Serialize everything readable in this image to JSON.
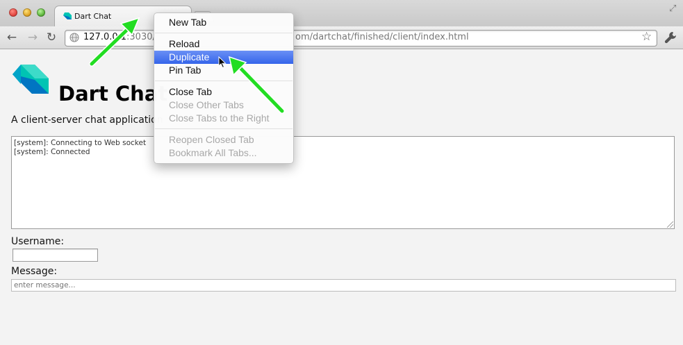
{
  "window": {
    "tab_title": "Dart Chat"
  },
  "toolbar": {
    "url_host": "127.0.0.1",
    "url_after_host": ":3030/",
    "url_tail": "om/dartchat/finished/client/index.html"
  },
  "page": {
    "title": "Dart Chat",
    "subtitle": "A client-server chat application",
    "chat_log": [
      "[system]: Connecting to Web socket",
      "[system]: Connected"
    ],
    "username_label": "Username:",
    "username_value": "",
    "message_label": "Message:",
    "message_placeholder": "enter message..."
  },
  "context_menu": {
    "items": [
      {
        "label": "New Tab",
        "state": "enabled"
      },
      {
        "label": "Reload",
        "state": "enabled"
      },
      {
        "label": "Duplicate",
        "state": "highlighted"
      },
      {
        "label": "Pin Tab",
        "state": "enabled"
      },
      {
        "label": "Close Tab",
        "state": "enabled"
      },
      {
        "label": "Close Other Tabs",
        "state": "disabled"
      },
      {
        "label": "Close Tabs to the Right",
        "state": "disabled"
      },
      {
        "label": "Reopen Closed Tab",
        "state": "disabled"
      },
      {
        "label": "Bookmark All Tabs...",
        "state": "disabled"
      }
    ]
  },
  "colors": {
    "menu_highlight": "#3565ea",
    "annotation_arrow": "#22dd22",
    "dart_teal": "#00c4b3",
    "dart_blue": "#0175c2"
  },
  "icons": {
    "back": "back-arrow-icon",
    "forward": "forward-arrow-icon",
    "reload": "reload-icon",
    "star": "star-icon",
    "wrench": "wrench-icon",
    "globe": "globe-icon"
  }
}
